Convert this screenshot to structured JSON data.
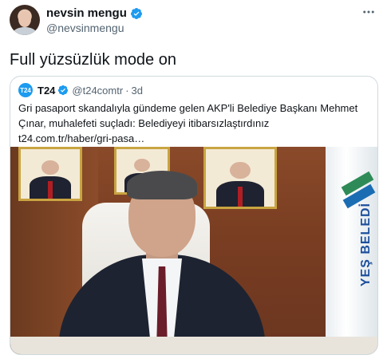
{
  "author": {
    "display_name": "nevsin mengu",
    "handle": "@nevsinmengu",
    "verified": true,
    "avatar_icon": "profile-photo"
  },
  "tweet": {
    "text": "Full yüzsüzlük mode on"
  },
  "more_icon": "ellipsis-icon",
  "quoted": {
    "logo_text": "T24",
    "name": "T24",
    "verified": true,
    "handle": "@t24comtr",
    "separator": "·",
    "time": "3d",
    "text": "Gri pasaport skandalıyla gündeme gelen AKP'li Belediye Başkanı Mehmet Çınar, muhalefeti suçladı: Belediyeyi itibarsızlaştırdınız",
    "link": "t24.com.tr/haber/gri-pasa…",
    "flag_text": "YEŞ BELEDİ"
  },
  "colors": {
    "text": "#0f1419",
    "secondary": "#536471",
    "verified_blue": "#1d9bf0",
    "border": "#cfd9de"
  }
}
